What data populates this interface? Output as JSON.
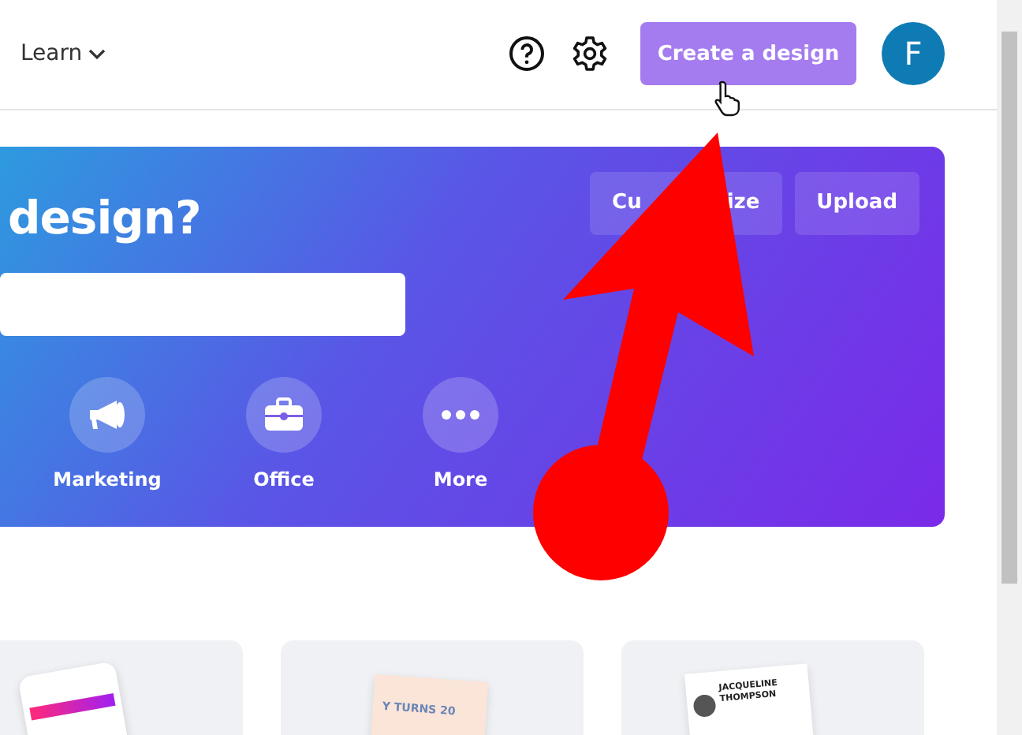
{
  "header": {
    "nav_item": "Learn",
    "create_button": "Create a design",
    "avatar_initial": "F"
  },
  "hero": {
    "heading": "design?",
    "actions": [
      {
        "label_parts": [
          "Cu",
          "ize"
        ]
      },
      {
        "label_parts": [
          "Upload"
        ]
      }
    ],
    "categories": [
      {
        "label": "Marketing",
        "kind": "megaphone"
      },
      {
        "label": "Office",
        "kind": "briefcase"
      },
      {
        "label": "More",
        "kind": "dots"
      }
    ]
  },
  "templates": [
    {
      "kind": "phone"
    },
    {
      "kind": "card",
      "text": "Y TURNS 20"
    },
    {
      "kind": "resume",
      "text": "JACQUELINE THOMPSON"
    }
  ]
}
